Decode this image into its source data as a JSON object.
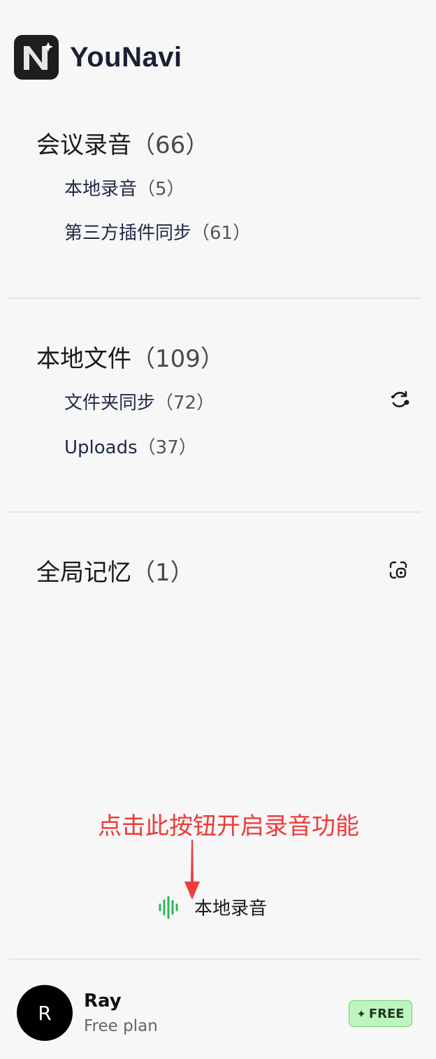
{
  "app": {
    "title": "YouNavi"
  },
  "meetings": {
    "title": "会议录音",
    "count": "（66）",
    "items": [
      {
        "label": "本地录音",
        "count": "（5）"
      },
      {
        "label": "第三方插件同步",
        "count": "（61）"
      }
    ]
  },
  "files": {
    "title": "本地文件",
    "count": "（109）",
    "items": [
      {
        "label": "文件夹同步",
        "count": "（72）"
      },
      {
        "label": "Uploads",
        "count": "（37）"
      }
    ]
  },
  "memory": {
    "title": "全局记忆",
    "count": "（1）"
  },
  "annotation": {
    "text": "点击此按钮开启录音功能",
    "color": "#ee3b3b"
  },
  "record_button": {
    "label": "本地录音",
    "icon": "waveform-icon",
    "color": "#2fb55b"
  },
  "user": {
    "avatar_letter": "R",
    "name": "Ray",
    "plan": "Free plan",
    "badge": "FREE",
    "badge_icon": "sparkle-icon"
  },
  "icons": {
    "sync": "sync-icon",
    "memory": "memory-scan-icon"
  }
}
